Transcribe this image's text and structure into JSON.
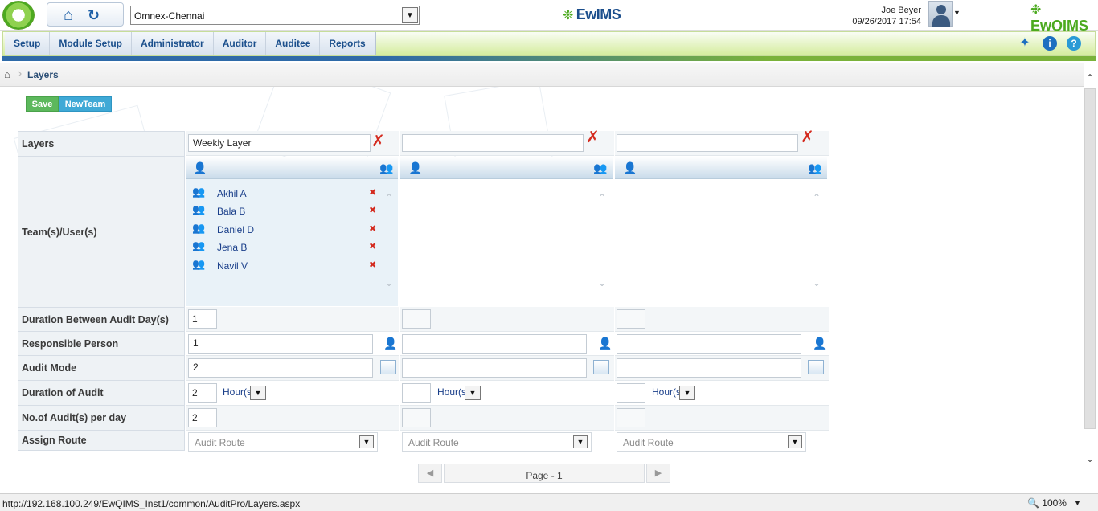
{
  "header": {
    "site_select_value": "Omnex-Chennai",
    "brand_center": "EwIMS",
    "user_name": "Joe Beyer",
    "datetime": "09/26/2017 17:54",
    "brand_right": "EwQIMS"
  },
  "menu": {
    "items": [
      "Setup",
      "Module Setup",
      "Administrator",
      "Auditor",
      "Auditee",
      "Reports"
    ]
  },
  "breadcrumb": {
    "current": "Layers"
  },
  "actions": {
    "save": "Save",
    "new_team": "NewTeam"
  },
  "labels": {
    "layers": "Layers",
    "teams_users": "Team(s)/User(s)",
    "duration_between": "Duration Between Audit Day(s)",
    "responsible": "Responsible Person",
    "audit_mode": "Audit Mode",
    "duration_audit": "Duration of Audit",
    "audits_per_day": "No.of Audit(s) per day",
    "assign_route": "Assign Route"
  },
  "columns": [
    {
      "layer_name": "Weekly Layer",
      "users": [
        "Akhil A",
        "Bala B",
        "Daniel D",
        "Jena B",
        "Navil V"
      ],
      "duration_between": "1",
      "responsible": "1",
      "audit_mode": "2",
      "duration_audit": "2",
      "duration_unit": "Hour(s)",
      "audits_per_day": "2",
      "route_placeholder": "Audit Route"
    },
    {
      "layer_name": "",
      "users": [],
      "duration_between": "",
      "responsible": "",
      "audit_mode": "",
      "duration_audit": "",
      "duration_unit": "Hour(s)",
      "audits_per_day": "",
      "route_placeholder": "Audit Route"
    },
    {
      "layer_name": "",
      "users": [],
      "duration_between": "",
      "responsible": "",
      "audit_mode": "",
      "duration_audit": "",
      "duration_unit": "Hour(s)",
      "audits_per_day": "",
      "route_placeholder": "Audit Route"
    }
  ],
  "pager": {
    "label": "Page - 1"
  },
  "statusbar": {
    "url": "http://192.168.100.249/EwQIMS_Inst1/common/AuditPro/Layers.aspx",
    "zoom": "100%"
  },
  "colors": {
    "menu_text": "#1b4f8c",
    "save_btn": "#5cb85c",
    "newteam_btn": "#3fa9d6",
    "delete_red": "#d42a1e",
    "accent_green": "#4caa1f"
  }
}
